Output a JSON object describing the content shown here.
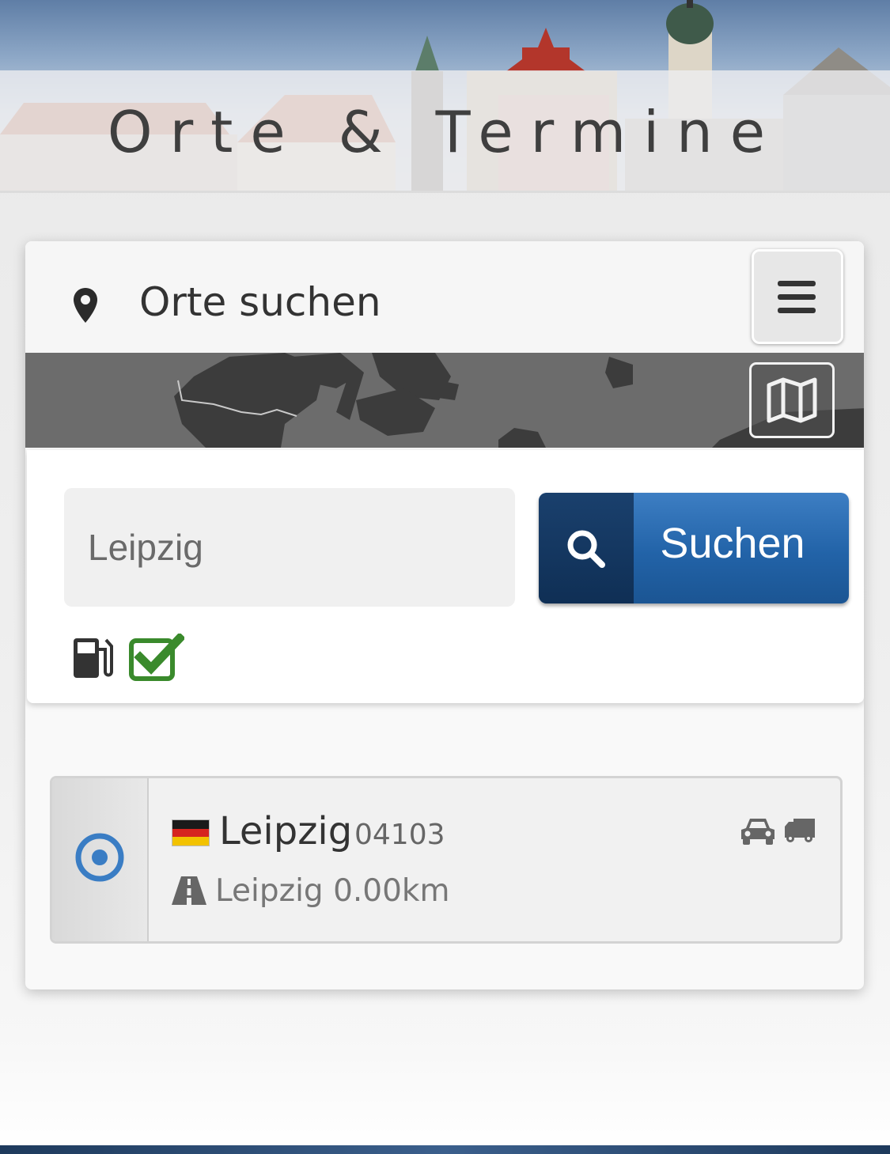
{
  "header": {
    "title": "Orte & Termine"
  },
  "search_card": {
    "title": "Orte suchen",
    "location_icon": "map-marker-icon",
    "menu_icon": "hamburger-icon",
    "map_icon": "map-icon",
    "input": {
      "value": "",
      "placeholder": "Leipzig"
    },
    "search_button": {
      "label": "Suchen",
      "icon": "search-icon"
    },
    "filters": {
      "fuel_icon": "gas-pump-icon",
      "fuel_checked": true
    }
  },
  "results": [
    {
      "flag": "de-flag",
      "name": "Leipzig",
      "zip": "04103",
      "distance": "Leipzig 0.00km",
      "selected": true,
      "vehicle_icons": [
        "car-icon",
        "truck-icon"
      ]
    }
  ],
  "colors": {
    "accent": "#2263a8",
    "accent_dark": "#0f2f55",
    "check": "#3a8a2c",
    "radio": "#3a7dc4"
  }
}
